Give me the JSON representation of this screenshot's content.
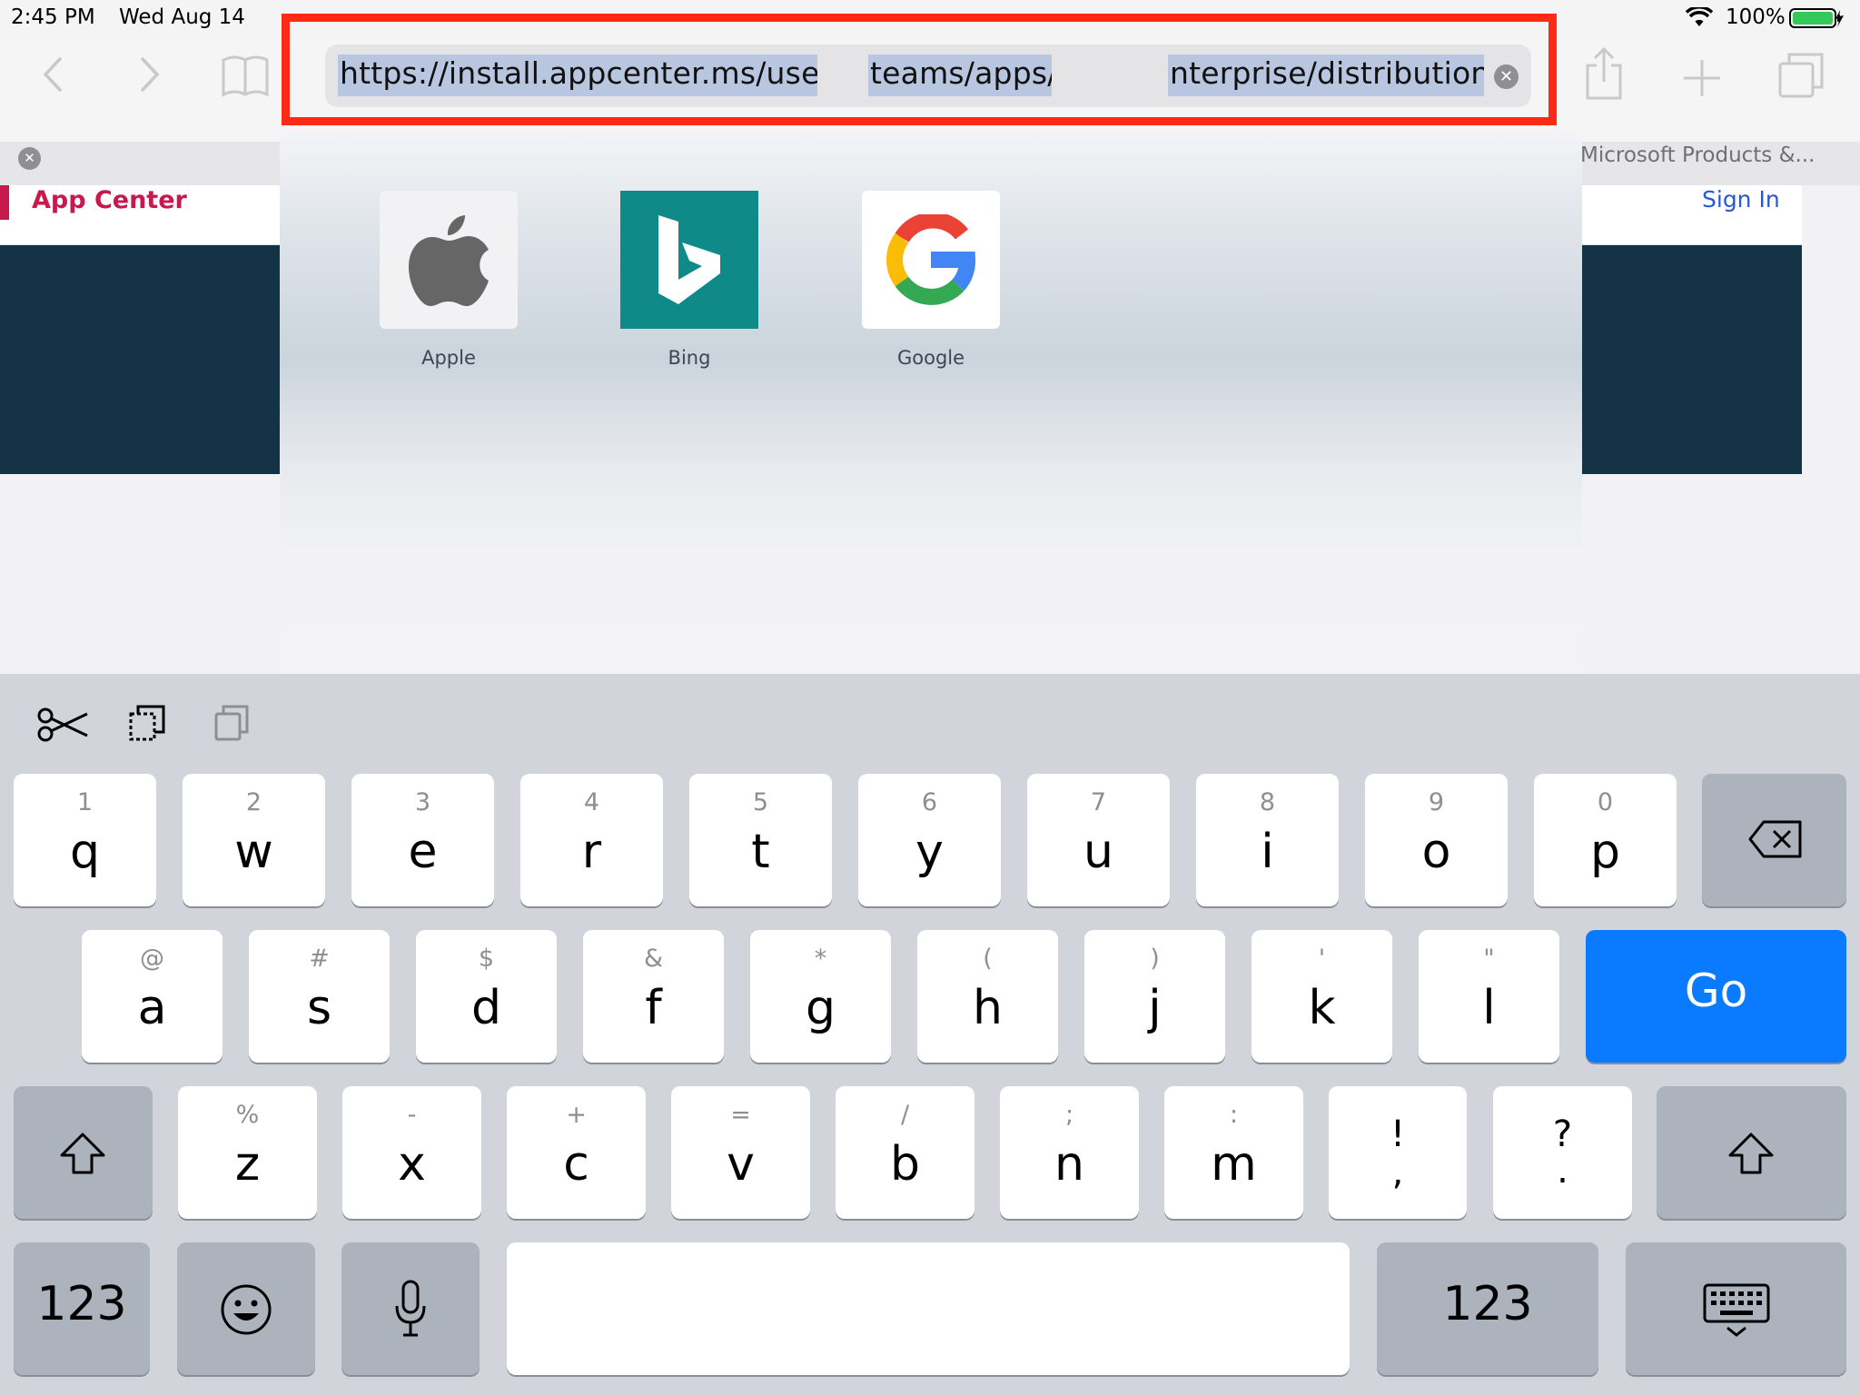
{
  "status_bar": {
    "time": "2:45 PM",
    "date": "Wed Aug 14",
    "battery": "100%"
  },
  "toolbar": {
    "url_part1": "https://install.appcenter.ms/users/",
    "url_part2": "teams/apps/",
    "url_part3": "nterprise/distribution_g",
    "highlight_color": "#ff2a16"
  },
  "page": {
    "tab_title": "Microsoft Products &...",
    "app_title": "App Center",
    "sign_in": "Sign In",
    "brand_color": "#c8194f"
  },
  "favorites": [
    {
      "name": "Apple",
      "icon": "apple-logo-icon"
    },
    {
      "name": "Bing",
      "icon": "bing-logo-icon"
    },
    {
      "name": "Google",
      "icon": "google-logo-icon"
    }
  ],
  "keyboard": {
    "row1": [
      {
        "k": "q",
        "s": "1"
      },
      {
        "k": "w",
        "s": "2"
      },
      {
        "k": "e",
        "s": "3"
      },
      {
        "k": "r",
        "s": "4"
      },
      {
        "k": "t",
        "s": "5"
      },
      {
        "k": "y",
        "s": "6"
      },
      {
        "k": "u",
        "s": "7"
      },
      {
        "k": "i",
        "s": "8"
      },
      {
        "k": "o",
        "s": "9"
      },
      {
        "k": "p",
        "s": "0"
      }
    ],
    "row2": [
      {
        "k": "a",
        "s": "@"
      },
      {
        "k": "s",
        "s": "#"
      },
      {
        "k": "d",
        "s": "$"
      },
      {
        "k": "f",
        "s": "&"
      },
      {
        "k": "g",
        "s": "*"
      },
      {
        "k": "h",
        "s": "("
      },
      {
        "k": "j",
        "s": ")"
      },
      {
        "k": "k",
        "s": "'"
      },
      {
        "k": "l",
        "s": "\""
      }
    ],
    "row3": [
      {
        "k": "z",
        "s": "%"
      },
      {
        "k": "x",
        "s": "-"
      },
      {
        "k": "c",
        "s": "+"
      },
      {
        "k": "v",
        "s": "="
      },
      {
        "k": "b",
        "s": "/"
      },
      {
        "k": "n",
        "s": ";"
      },
      {
        "k": "m",
        "s": ":"
      }
    ],
    "exclaim_top": "!",
    "exclaim_bottom": ",",
    "question_top": "?",
    "question_bottom": ".",
    "go_label": "Go",
    "num_label_left": "123",
    "num_label_right": "123",
    "go_color": "#0a7bff"
  }
}
